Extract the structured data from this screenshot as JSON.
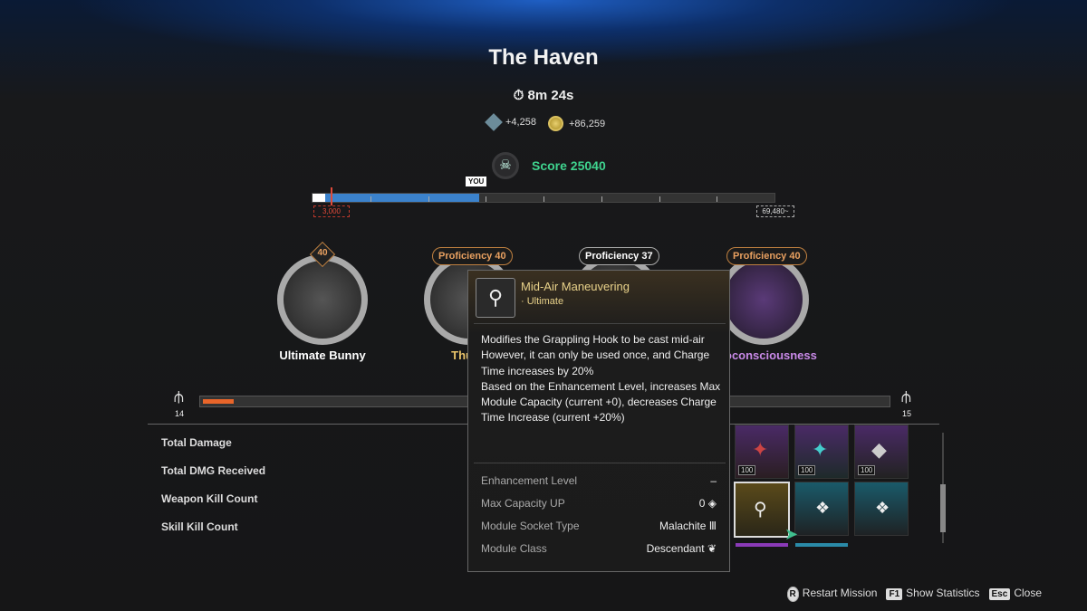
{
  "header": {
    "title": "The Haven",
    "timer": "8m 24s",
    "rewards": [
      {
        "icon": "crystal-icon",
        "value": "+4,258"
      },
      {
        "icon": "gold-coin-icon",
        "value": "+86,259"
      }
    ],
    "score": "Score 25040"
  },
  "progress": {
    "you_label": "YOU",
    "fill_fraction": 0.36,
    "min_marker": "3,000",
    "max_marker": "69,480~",
    "colors": {
      "fill": "#3b82cc",
      "marker": "#e04a3a"
    }
  },
  "loadout": [
    {
      "name": "Ultimate Bunny",
      "badge": "40",
      "color": "#ffffff"
    },
    {
      "name": "Thund",
      "proficiency": "Proficiency 40",
      "color": "#e9c46a"
    },
    {
      "name": "",
      "proficiency": "Proficiency 37",
      "color": "#ffffff"
    },
    {
      "name": "oconsciousness",
      "proficiency": "Proficiency 40",
      "color": "#c98ae8"
    }
  ],
  "capacity": {
    "left": "14",
    "right": "15",
    "fill_fraction": 0.045
  },
  "stats": [
    "Total Damage",
    "Total DMG Received",
    "Weapon Kill Count",
    "Skill Kill Count"
  ],
  "modules": [
    {
      "level": "100"
    },
    {
      "level": "100"
    },
    {
      "level": "100"
    },
    {},
    {},
    {}
  ],
  "tooltip": {
    "name": "Mid-Air Maneuvering",
    "type": "· Ultimate",
    "description": "Modifies the Grappling Hook to be cast mid-air\nHowever, it can only be used once, and Charge Time increases by 20%\nBased on the Enhancement Level, increases Max Module Capacity (current +0), decreases Charge Time Increase (current +20%)",
    "props": [
      {
        "label": "Enhancement Level",
        "value": "–"
      },
      {
        "label": "Max Capacity UP",
        "value": "0 ◈"
      },
      {
        "label": "Module Socket Type",
        "value": "Malachite Ⅲ"
      },
      {
        "label": "Module Class",
        "value": "Descendant ❦"
      }
    ]
  },
  "footer": [
    {
      "key": "R",
      "label": "Restart Mission"
    },
    {
      "key": "F1",
      "label": "Show Statistics"
    },
    {
      "key": "Esc",
      "label": "Close"
    }
  ]
}
